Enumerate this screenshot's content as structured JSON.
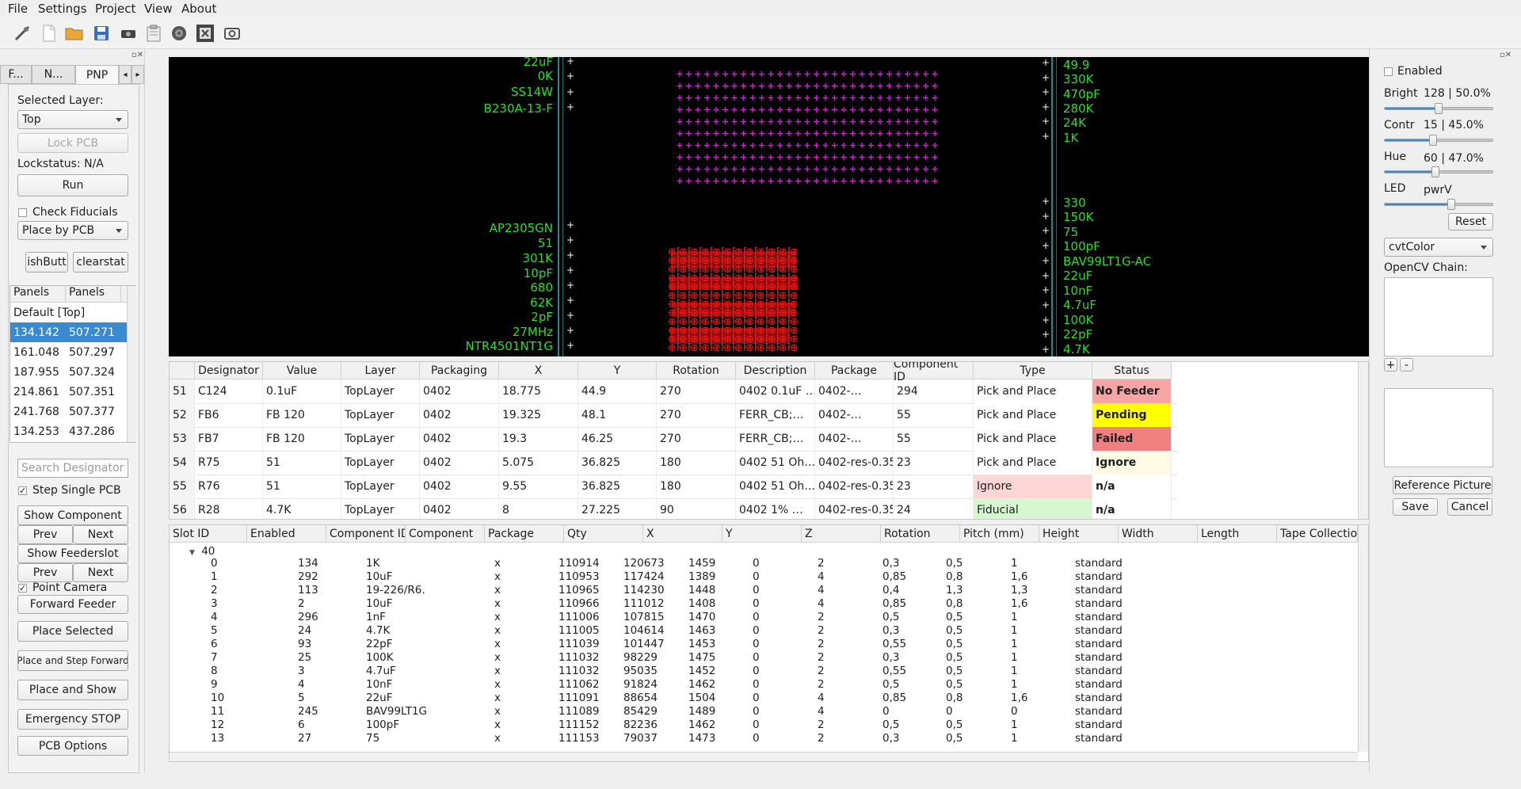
{
  "menu": {
    "file": "File",
    "settings": "Settings",
    "project": "Project",
    "view": "View",
    "about": "About"
  },
  "toolbar": {
    "icons": [
      "connect-icon",
      "new-file-icon",
      "open-folder-icon",
      "save-icon",
      "camera-icon",
      "paste-icon",
      "reel-icon",
      "gear-board-icon",
      "screenshot-icon"
    ]
  },
  "left": {
    "tabs": [
      "F...",
      "N...",
      "PNP"
    ],
    "selected_layer_label": "Selected Layer:",
    "layer_value": "Top",
    "lock_pcb": "Lock PCB",
    "lockstatus": "Lockstatus: N/A",
    "run": "Run",
    "check_fiducials": "Check Fiducials",
    "place_mode": "Place by PCB",
    "push_button": "ishButt",
    "clearstat": "clearstat",
    "panels": {
      "headers": [
        "Panels",
        "Panels"
      ],
      "rows": [
        [
          "Default [Top]",
          ""
        ],
        [
          "134.142",
          "507.271"
        ],
        [
          "161.048",
          "507.297"
        ],
        [
          "187.955",
          "507.324"
        ],
        [
          "214.861",
          "507.351"
        ],
        [
          "241.768",
          "507.377"
        ],
        [
          "134.253",
          "437.286"
        ]
      ]
    },
    "search_placeholder": "Search Designator",
    "step_single_pcb": "Step Single PCB",
    "show_component": "Show Component",
    "prev": "Prev",
    "next": "Next",
    "show_feederslot": "Show Feederslot",
    "point_camera": "Point Camera",
    "forward_feeder": "Forward Feeder",
    "place_selected": "Place Selected",
    "place_step_forward": "Place and Step Forward",
    "place_and_show": "Place and Show",
    "emergency_stop": "Emergency STOP",
    "pcb_options": "PCB Options"
  },
  "canvas": {
    "left_labels_top": [
      "22uF",
      "0K",
      "SS14W",
      "B230A-13-F"
    ],
    "left_labels_bottom": [
      "AP2305GN",
      "51",
      "301K",
      "10pF",
      "680",
      "62K",
      "2pF",
      "27MHz",
      "NTR4501NT1G"
    ],
    "right_labels_top": [
      "49.9",
      "330K",
      "470pF",
      "280K",
      "24K",
      "1K"
    ],
    "right_labels_bottom": [
      "330",
      "150K",
      "75",
      "100pF",
      "BAV99LT1G-AC",
      "22uF",
      "10nF",
      "4.7uF",
      "100K",
      "22pF",
      "4.7K"
    ],
    "colors": {
      "labels": "#2ddc2d",
      "grid": "#d020d0",
      "markers": "#ff1a1a"
    }
  },
  "components": {
    "headers": [
      "Designator",
      "Value",
      "Layer",
      "Packaging",
      "X",
      "Y",
      "Rotation",
      "Description",
      "Package",
      "Component ID",
      "Type",
      "Status"
    ],
    "rows": [
      {
        "n": "51",
        "designator": "C124",
        "value": "0.1uF",
        "layer": "TopLayer",
        "packaging": "0402",
        "x": "18.775",
        "y": "44.9",
        "rotation": "270",
        "description": "0402 0.1uF …",
        "package": "0402-…",
        "component_id": "294",
        "type": "Pick and Place",
        "status": "No Feeder"
      },
      {
        "n": "52",
        "designator": "FB6",
        "value": "FB 120",
        "layer": "TopLayer",
        "packaging": "0402",
        "x": "19.325",
        "y": "48.1",
        "rotation": "270",
        "description": "FERR_CB;…",
        "package": "0402-…",
        "component_id": "55",
        "type": "Pick and Place",
        "status": "Pending"
      },
      {
        "n": "53",
        "designator": "FB7",
        "value": "FB 120",
        "layer": "TopLayer",
        "packaging": "0402",
        "x": "19.3",
        "y": "46.25",
        "rotation": "270",
        "description": "FERR_CB;…",
        "package": "0402-…",
        "component_id": "55",
        "type": "Pick and Place",
        "status": "Failed"
      },
      {
        "n": "54",
        "designator": "R75",
        "value": "51",
        "layer": "TopLayer",
        "packaging": "0402",
        "x": "5.075",
        "y": "36.825",
        "rotation": "180",
        "description": "0402 51 Oh…",
        "package": "0402-res-0.35",
        "component_id": "23",
        "type": "Pick and Place",
        "status": "Ignore"
      },
      {
        "n": "55",
        "designator": "R76",
        "value": "51",
        "layer": "TopLayer",
        "packaging": "0402",
        "x": "9.55",
        "y": "36.825",
        "rotation": "180",
        "description": "0402 51 Oh…",
        "package": "0402-res-0.35",
        "component_id": "23",
        "type": "Ignore",
        "status": "n/a"
      },
      {
        "n": "56",
        "designator": "R28",
        "value": "4.7K",
        "layer": "TopLayer",
        "packaging": "0402",
        "x": "8",
        "y": "27.225",
        "rotation": "90",
        "description": "0402 1% …",
        "package": "0402-res-0.35",
        "component_id": "24",
        "type": "Fiducial",
        "status": "n/a"
      }
    ],
    "status_colors": {
      "No Feeder": "#f7a4a4",
      "Pending": "#ffff00",
      "Failed": "#f07f7f",
      "Ignore": "#fffbe6",
      "n/a": "#ffffff"
    },
    "type_colors": {
      "Pick and Place": "#ffffff",
      "Ignore": "#fdd6d6",
      "Fiducial": "#d6f7d2"
    }
  },
  "feeders": {
    "headers": [
      "Slot ID",
      "Enabled",
      "Component ID",
      "Component",
      "Package",
      "Qty",
      "X",
      "Y",
      "Z",
      "Rotation",
      "Pitch (mm)",
      "Height",
      "Width",
      "Length",
      "Tape Collectio"
    ],
    "group": "40",
    "rows": [
      [
        "0",
        "",
        "134",
        "1K",
        "",
        "x",
        "110914",
        "120673",
        "1459",
        "0",
        "2",
        "0,3",
        "0,5",
        "1",
        "standard"
      ],
      [
        "1",
        "",
        "292",
        "10uF",
        "",
        "x",
        "110953",
        "117424",
        "1389",
        "0",
        "4",
        "0,85",
        "0,8",
        "1,6",
        "standard"
      ],
      [
        "2",
        "",
        "113",
        "19-226/R6…",
        "",
        "x",
        "110965",
        "114230",
        "1448",
        "0",
        "4",
        "0,4",
        "1,3",
        "1,3",
        "standard"
      ],
      [
        "3",
        "",
        "2",
        "10uF",
        "",
        "x",
        "110966",
        "111012",
        "1408",
        "0",
        "4",
        "0,85",
        "0,8",
        "1,6",
        "standard"
      ],
      [
        "4",
        "",
        "296",
        "1nF",
        "",
        "x",
        "111006",
        "107815",
        "1470",
        "0",
        "2",
        "0,5",
        "0,5",
        "1",
        "standard"
      ],
      [
        "5",
        "",
        "24",
        "4.7K",
        "",
        "x",
        "111005",
        "104614",
        "1463",
        "0",
        "2",
        "0,3",
        "0,5",
        "1",
        "standard"
      ],
      [
        "6",
        "",
        "93",
        "22pF",
        "",
        "x",
        "111039",
        "101447",
        "1453",
        "0",
        "2",
        "0,55",
        "0,5",
        "1",
        "standard"
      ],
      [
        "7",
        "",
        "25",
        "100K",
        "",
        "x",
        "111032",
        "98229",
        "1475",
        "0",
        "2",
        "0,3",
        "0,5",
        "1",
        "standard"
      ],
      [
        "8",
        "",
        "3",
        "4.7uF",
        "",
        "x",
        "111032",
        "95035",
        "1452",
        "0",
        "2",
        "0,55",
        "0,5",
        "1",
        "standard"
      ],
      [
        "9",
        "",
        "4",
        "10nF",
        "",
        "x",
        "111062",
        "91824",
        "1462",
        "0",
        "2",
        "0,5",
        "0,5",
        "1",
        "standard"
      ],
      [
        "10",
        "",
        "5",
        "22uF",
        "",
        "x",
        "111091",
        "88654",
        "1504",
        "0",
        "4",
        "0,85",
        "0,8",
        "1,6",
        "standard"
      ],
      [
        "11",
        "",
        "245",
        "BAV99LT1G…",
        "",
        "x",
        "111089",
        "85429",
        "1489",
        "0",
        "4",
        "0",
        "0",
        "0",
        "standard"
      ],
      [
        "12",
        "",
        "6",
        "100pF",
        "",
        "x",
        "111152",
        "82236",
        "1462",
        "0",
        "2",
        "0,5",
        "0,5",
        "1",
        "standard"
      ],
      [
        "13",
        "",
        "27",
        "75",
        "",
        "x",
        "111153",
        "79037",
        "1473",
        "0",
        "2",
        "0,3",
        "0,5",
        "1",
        "standard"
      ]
    ]
  },
  "right": {
    "enabled": "Enabled",
    "bright_label": "Bright",
    "bright_value": "128 | 50.0%",
    "bright_level": 0.5,
    "contr_label": "Contr",
    "contr_value": "15 | 45.0%",
    "contr_level": 0.45,
    "hue_label": "Hue",
    "hue_value": "60 | 47.0%",
    "hue_level": 0.47,
    "led_label": "LED",
    "led_value": "pwrV",
    "led_level": 0.62,
    "reset": "Reset",
    "cvt_color": "cvtColor",
    "opencv_chain": "OpenCV Chain:",
    "plus": "+",
    "minus": "-",
    "reference_picture": "Reference Picture",
    "save": "Save",
    "cancel": "Cancel"
  }
}
